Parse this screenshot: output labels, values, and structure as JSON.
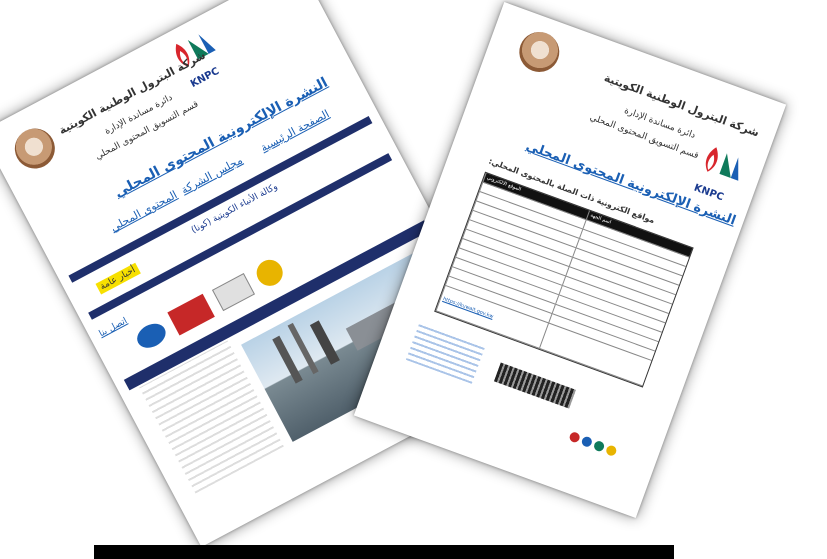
{
  "page1": {
    "company_name": "شركة البترول الوطنية الكويتية",
    "department": "دائرة مساندة الإدارة",
    "section": "قسم التسويق المحتوى المحلي",
    "bulletin_title": "النشرة الإلكترونية المحتوى المحلي",
    "nav_home": "الصفحة الرئيسية",
    "nav_company": "مجلس الشركة",
    "nav_content": "المحتوى المحلي",
    "knpc_label": "KNPC",
    "news_agency": "وكالة الأنباء الكويتية (كونا)",
    "highlight_badge": "أخبار عامة",
    "contact_link": "اتصل بنا"
  },
  "page2": {
    "company_name": "شركة البترول الوطنية الكويتية",
    "department": "دائرة مساندة الإدارة",
    "section": "قسم التسويق المحتوى المحلي",
    "bulletin_title": "النشرة الإلكترونية المحتوى المحلي",
    "knpc_label": "KNPC",
    "table_heading": "مواقع الكترونية ذات الصلة بالمحتوى المحلي:",
    "table_headers": [
      "الموقع الالكتروني",
      "اسم الجهة"
    ],
    "footer_link": "https://kuwait.gov.kw"
  }
}
